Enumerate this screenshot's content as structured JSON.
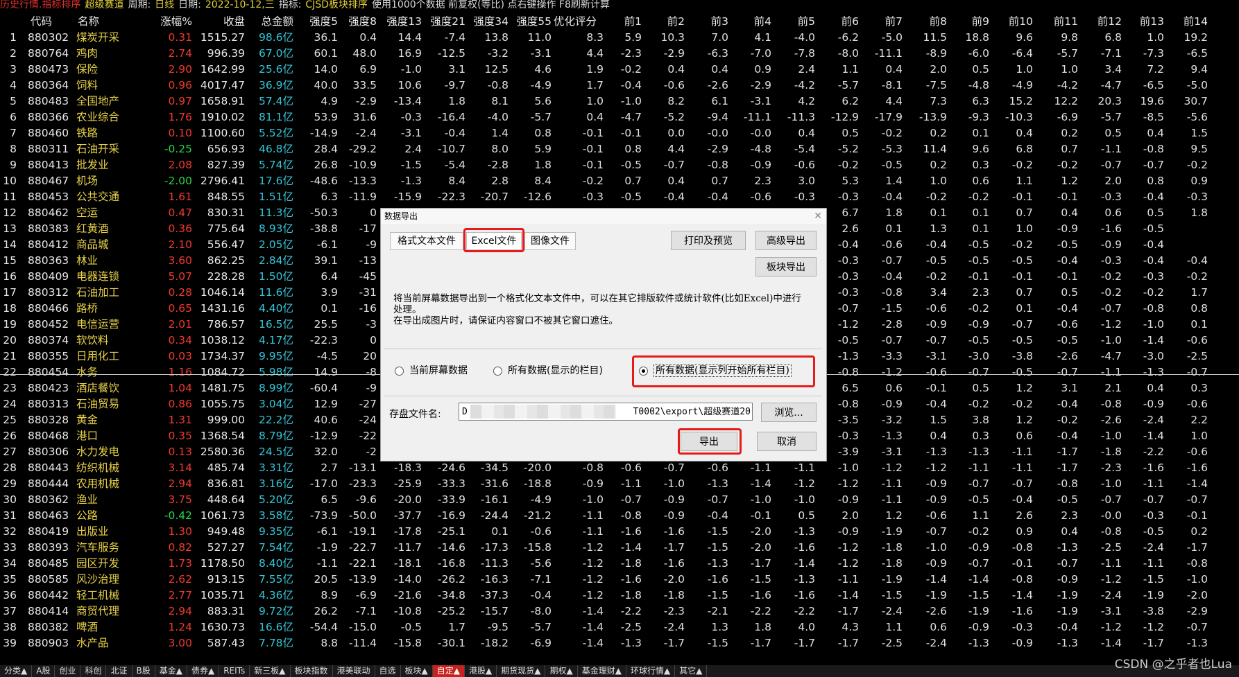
{
  "titlebar": {
    "mode": "历史行情.指标排序",
    "block": "超级赛道",
    "period_label": "周期:",
    "period": "日线",
    "date_label": "日期:",
    "date": "2022-10-12,三",
    "indicator_label": "指标:",
    "indicator": "CJSD板块排序",
    "info": "使用1000个数据 前复权(等比) 点右键操作 F8刷新计算"
  },
  "columns": [
    "代码",
    "名称",
    "涨幅%",
    "收盘",
    "总金额",
    "强度5",
    "强度8",
    "强度13",
    "强度21",
    "强度34",
    "强度55",
    "优化评分",
    "前1",
    "前2",
    "前3",
    "前4",
    "前5",
    "前6",
    "前7",
    "前8",
    "前9",
    "前10",
    "前11",
    "前12",
    "前13",
    "前14"
  ],
  "rows": [
    [
      "1",
      "880302",
      "煤炭开采",
      "0.31",
      "1515.27",
      "98.6亿",
      "36.1",
      "0.4",
      "14.4",
      "-7.4",
      "13.8",
      "11.0",
      "8.3",
      "5.9",
      "10.3",
      "7.0",
      "4.1",
      "-4.0",
      "-6.2",
      "-5.0",
      "11.5",
      "18.8",
      "9.6",
      "9.8",
      "6.8",
      "1.0",
      "19.2"
    ],
    [
      "2",
      "880764",
      "鸡肉",
      "2.74",
      "996.39",
      "67.0亿",
      "60.1",
      "48.0",
      "16.9",
      "-12.5",
      "-3.2",
      "-3.1",
      "4.4",
      "-2.3",
      "-2.9",
      "-6.3",
      "-7.0",
      "-7.8",
      "-8.0",
      "-11.1",
      "-8.9",
      "-6.0",
      "-6.4",
      "-5.7",
      "-7.1",
      "-7.3",
      "-6.5"
    ],
    [
      "3",
      "880473",
      "保险",
      "2.90",
      "1642.99",
      "25.6亿",
      "14.0",
      "6.9",
      "-1.0",
      "3.1",
      "12.5",
      "4.6",
      "1.9",
      "-0.2",
      "0.4",
      "0.4",
      "0.9",
      "2.4",
      "1.1",
      "0.4",
      "2.0",
      "0.5",
      "1.0",
      "1.0",
      "3.4",
      "7.2",
      "9.4"
    ],
    [
      "4",
      "880364",
      "饲料",
      "0.96",
      "4017.47",
      "36.9亿",
      "40.0",
      "33.5",
      "10.6",
      "-9.7",
      "-0.8",
      "-4.9",
      "1.7",
      "-0.4",
      "-0.6",
      "-2.6",
      "-2.9",
      "-4.2",
      "-5.7",
      "-8.1",
      "-7.5",
      "-4.8",
      "-4.9",
      "-4.2",
      "-4.7",
      "-6.5",
      "-5.0"
    ],
    [
      "5",
      "880483",
      "全国地产",
      "0.97",
      "1658.91",
      "57.4亿",
      "4.9",
      "-2.9",
      "-13.4",
      "1.8",
      "8.1",
      "5.6",
      "1.0",
      "-1.0",
      "8.2",
      "6.1",
      "-3.1",
      "4.2",
      "6.2",
      "4.4",
      "7.3",
      "6.3",
      "15.2",
      "12.2",
      "20.3",
      "19.6",
      "30.7"
    ],
    [
      "6",
      "880366",
      "农业综合",
      "1.76",
      "1910.02",
      "81.1亿",
      "53.9",
      "31.6",
      "-0.3",
      "-16.4",
      "-4.0",
      "-5.7",
      "0.4",
      "-4.7",
      "-5.2",
      "-9.4",
      "-11.1",
      "-11.3",
      "-12.9",
      "-17.9",
      "-13.9",
      "-9.3",
      "-10.3",
      "-6.9",
      "-5.7",
      "-8.5",
      "-5.6"
    ],
    [
      "7",
      "880460",
      "铁路",
      "0.10",
      "1100.60",
      "5.52亿",
      "-14.9",
      "-2.4",
      "-3.1",
      "-0.4",
      "1.4",
      "0.8",
      "-0.1",
      "-0.1",
      "0.0",
      "-0.0",
      "-0.0",
      "0.4",
      "0.5",
      "-0.2",
      "0.2",
      "0.1",
      "0.4",
      "0.2",
      "0.5",
      "0.4",
      "1.5"
    ],
    [
      "8",
      "880311",
      "石油开采",
      "-0.25",
      "656.93",
      "46.8亿",
      "28.4",
      "-29.2",
      "2.4",
      "-10.7",
      "8.0",
      "5.9",
      "-0.1",
      "0.8",
      "4.4",
      "-2.9",
      "-4.8",
      "-5.4",
      "-5.2",
      "-5.3",
      "11.4",
      "9.6",
      "6.8",
      "0.7",
      "-1.1",
      "-0.8",
      "9.5"
    ],
    [
      "9",
      "880413",
      "批发业",
      "2.08",
      "827.39",
      "5.74亿",
      "26.8",
      "-10.9",
      "-1.5",
      "-5.4",
      "-2.8",
      "1.8",
      "-0.1",
      "-0.5",
      "-0.7",
      "-0.8",
      "-0.9",
      "-0.6",
      "-0.2",
      "-0.5",
      "0.2",
      "0.3",
      "-0.2",
      "-0.2",
      "-0.7",
      "-0.7",
      "-0.2"
    ],
    [
      "10",
      "880467",
      "机场",
      "-2.00",
      "2796.41",
      "17.6亿",
      "-48.6",
      "-13.3",
      "-1.3",
      "8.4",
      "2.8",
      "8.4",
      "-0.2",
      "0.7",
      "0.4",
      "0.7",
      "2.3",
      "3.0",
      "5.3",
      "1.4",
      "1.0",
      "0.6",
      "1.1",
      "1.2",
      "2.0",
      "0.8",
      "0.9"
    ],
    [
      "11",
      "880453",
      "公共交通",
      "1.61",
      "848.55",
      "1.51亿",
      "6.3",
      "-11.9",
      "-15.9",
      "-22.3",
      "-20.7",
      "-12.6",
      "-0.3",
      "-0.5",
      "-0.4",
      "-0.4",
      "-0.6",
      "-0.3",
      "-0.3",
      "-0.4",
      "-0.2",
      "-0.2",
      "-0.1",
      "-0.1",
      "-0.3",
      "-0.4",
      "-0.3"
    ],
    [
      "12",
      "880462",
      "空运",
      "0.47",
      "830.31",
      "11.3亿",
      "-50.3",
      "0",
      "",
      "",
      "",
      "",
      "",
      "",
      "",
      "",
      "",
      "",
      "6.7",
      "1.8",
      "0.1",
      "0.1",
      "0.7",
      "0.4",
      "0.6",
      "0.5",
      "1.8"
    ],
    [
      "13",
      "880383",
      "红黄酒",
      "0.36",
      "775.64",
      "8.93亿",
      "-38.8",
      "-17",
      "",
      "",
      "",
      "",
      "",
      "",
      "",
      "",
      "",
      "",
      "2.6",
      "0.1",
      "1.3",
      "0.1",
      "1.0",
      "-0.9",
      "-1.6",
      "-0.5",
      ""
    ],
    [
      "14",
      "880412",
      "商品城",
      "2.10",
      "556.47",
      "2.05亿",
      "-6.1",
      "-9",
      "",
      "",
      "",
      "",
      "",
      "",
      "",
      "",
      "",
      "",
      "-0.4",
      "-0.6",
      "-0.4",
      "-0.5",
      "-0.2",
      "-0.5",
      "-0.9",
      "-0.4",
      ""
    ],
    [
      "15",
      "880363",
      "林业",
      "3.60",
      "862.25",
      "2.84亿",
      "39.1",
      "-13",
      "",
      "",
      "",
      "",
      "",
      "",
      "",
      "",
      "",
      "",
      "-0.3",
      "-0.7",
      "-0.5",
      "-0.5",
      "-0.5",
      "-0.4",
      "-0.3",
      "-0.4",
      "-0.4"
    ],
    [
      "16",
      "880409",
      "电器连锁",
      "5.07",
      "228.28",
      "1.50亿",
      "6.4",
      "-45",
      "",
      "",
      "",
      "",
      "",
      "",
      "",
      "",
      "",
      "",
      "-0.3",
      "-0.4",
      "-0.2",
      "-0.1",
      "-0.1",
      "-0.1",
      "-0.2",
      "-0.3",
      "-0.2"
    ],
    [
      "17",
      "880312",
      "石油加工",
      "0.28",
      "1046.14",
      "11.6亿",
      "3.9",
      "-31",
      "",
      "",
      "",
      "",
      "",
      "",
      "",
      "",
      "",
      "",
      "-0.3",
      "-0.8",
      "3.4",
      "2.3",
      "0.7",
      "0.5",
      "-0.2",
      "-0.2",
      "1.7"
    ],
    [
      "18",
      "880466",
      "路桥",
      "0.65",
      "1431.16",
      "4.40亿",
      "0.1",
      "-16",
      "",
      "",
      "",
      "",
      "",
      "",
      "",
      "",
      "",
      "",
      "-0.7",
      "-1.5",
      "-0.6",
      "-0.2",
      "0.1",
      "-0.4",
      "-0.7",
      "-0.8",
      "0.8"
    ],
    [
      "19",
      "880452",
      "电信运营",
      "2.01",
      "786.57",
      "16.5亿",
      "25.5",
      "-3",
      "",
      "",
      "",
      "",
      "",
      "",
      "",
      "",
      "",
      "",
      "-1.2",
      "-2.8",
      "-0.9",
      "-0.9",
      "-0.7",
      "-0.6",
      "-1.2",
      "-1.0",
      "0.1"
    ],
    [
      "20",
      "880374",
      "软饮料",
      "0.34",
      "1038.12",
      "4.17亿",
      "-22.3",
      "0",
      "",
      "",
      "",
      "",
      "",
      "",
      "",
      "",
      "",
      "",
      "-0.5",
      "-0.7",
      "-0.7",
      "-0.5",
      "-0.5",
      "-0.5",
      "-1.0",
      "-1.4",
      "-0.6"
    ],
    [
      "21",
      "880355",
      "日用化工",
      "0.03",
      "1734.37",
      "9.95亿",
      "-4.5",
      "20",
      "",
      "",
      "",
      "",
      "",
      "",
      "",
      "",
      "",
      "",
      "-1.3",
      "-3.3",
      "-3.1",
      "-3.0",
      "-3.8",
      "-2.6",
      "-4.7",
      "-3.0",
      "-2.5"
    ],
    [
      "22",
      "880454",
      "水务",
      "1.16",
      "1084.72",
      "5.98亿",
      "14.9",
      "-8",
      "",
      "",
      "",
      "",
      "",
      "",
      "",
      "",
      "",
      "",
      "-0.8",
      "-1.2",
      "-0.6",
      "-0.7",
      "-0.5",
      "-0.7",
      "-1.1",
      "-1.3",
      "-0.7"
    ],
    [
      "23",
      "880423",
      "酒店餐饮",
      "1.04",
      "1481.75",
      "8.99亿",
      "-60.4",
      "-9",
      "",
      "",
      "",
      "",
      "",
      "",
      "",
      "",
      "",
      "",
      "6.5",
      "0.6",
      "-0.1",
      "0.5",
      "1.2",
      "3.1",
      "2.1",
      "0.4",
      "0.3"
    ],
    [
      "24",
      "880313",
      "石油贸易",
      "0.86",
      "1055.75",
      "3.04亿",
      "12.9",
      "-27",
      "",
      "",
      "",
      "",
      "",
      "",
      "",
      "",
      "",
      "",
      "-0.8",
      "-0.9",
      "-0.4",
      "-0.2",
      "-0.2",
      "-0.4",
      "-0.8",
      "-0.9",
      "-0.6"
    ],
    [
      "25",
      "880328",
      "黄金",
      "1.31",
      "999.00",
      "22.2亿",
      "40.6",
      "-24",
      "",
      "",
      "",
      "",
      "",
      "",
      "",
      "",
      "",
      "",
      "-3.5",
      "-3.2",
      "1.5",
      "3.8",
      "1.2",
      "-0.2",
      "-2.6",
      "-2.4",
      "2.2"
    ],
    [
      "26",
      "880468",
      "港口",
      "0.35",
      "1368.54",
      "8.79亿",
      "-12.9",
      "-22",
      "",
      "",
      "",
      "",
      "",
      "",
      "",
      "",
      "",
      "",
      "-0.3",
      "-1.3",
      "0.4",
      "0.3",
      "0.6",
      "-0.4",
      "-1.0",
      "-1.4",
      "1.0"
    ],
    [
      "27",
      "880306",
      "水力发电",
      "0.13",
      "2580.36",
      "24.5亿",
      "32.0",
      "-2",
      "",
      "",
      "",
      "",
      "",
      "",
      "",
      "",
      "",
      "",
      "-3.9",
      "-3.1",
      "-1.3",
      "-1.3",
      "-1.1",
      "-1.7",
      "-1.8",
      "-2.2",
      "-0.6"
    ],
    [
      "28",
      "880443",
      "纺织机械",
      "3.14",
      "485.74",
      "3.31亿",
      "2.7",
      "-13.1",
      "-18.3",
      "-24.6",
      "-34.5",
      "-20.0",
      "-0.8",
      "-0.6",
      "-0.7",
      "-0.6",
      "-1.1",
      "-1.1",
      "-1.0",
      "-1.2",
      "-1.2",
      "-1.1",
      "-1.1",
      "-1.7",
      "-2.3",
      "-1.6",
      "-1.6"
    ],
    [
      "29",
      "880444",
      "农用机械",
      "2.94",
      "836.81",
      "3.16亿",
      "-17.0",
      "-23.3",
      "-25.9",
      "-33.3",
      "-31.6",
      "-18.8",
      "-0.9",
      "-1.1",
      "-1.0",
      "-1.3",
      "-1.4",
      "-1.2",
      "-1.2",
      "-1.1",
      "-0.9",
      "-0.7",
      "-0.7",
      "-0.8",
      "-1.0",
      "-1.1",
      "-1.4"
    ],
    [
      "30",
      "880362",
      "渔业",
      "3.75",
      "448.64",
      "5.20亿",
      "6.5",
      "-9.6",
      "-20.0",
      "-33.9",
      "-16.1",
      "-4.9",
      "-1.0",
      "-0.7",
      "-0.9",
      "-0.7",
      "-1.0",
      "-1.0",
      "-0.9",
      "-1.1",
      "-0.9",
      "-0.5",
      "-0.4",
      "-0.5",
      "-0.7",
      "-0.7",
      "-0.7"
    ],
    [
      "31",
      "880463",
      "公路",
      "-0.42",
      "1061.73",
      "3.58亿",
      "-73.9",
      "-50.0",
      "-37.7",
      "-16.9",
      "-24.4",
      "-21.2",
      "-1.1",
      "-0.8",
      "-0.9",
      "-0.4",
      "-0.1",
      "0.5",
      "2.0",
      "1.2",
      "-0.6",
      "1.1",
      "2.6",
      "2.3",
      "-0.0",
      "-0.3",
      "-0.1"
    ],
    [
      "32",
      "880419",
      "出版业",
      "1.30",
      "949.48",
      "9.35亿",
      "-6.1",
      "-19.1",
      "-17.8",
      "-25.1",
      "0.1",
      "-0.6",
      "-1.1",
      "-1.6",
      "-1.6",
      "-1.5",
      "-2.0",
      "-1.3",
      "-0.9",
      "-1.9",
      "-0.7",
      "-0.2",
      "0.9",
      "0.4",
      "-0.8",
      "-0.5",
      "0.2"
    ],
    [
      "33",
      "880393",
      "汽车服务",
      "0.82",
      "527.27",
      "7.54亿",
      "-1.9",
      "-22.7",
      "-11.7",
      "-14.6",
      "-17.3",
      "-15.8",
      "-1.2",
      "-1.4",
      "-1.7",
      "-1.5",
      "-2.0",
      "-1.6",
      "-1.2",
      "-1.8",
      "-1.0",
      "-0.9",
      "-0.8",
      "-1.3",
      "-2.5",
      "-2.4",
      "-1.7"
    ],
    [
      "34",
      "880485",
      "园区开发",
      "1.73",
      "1178.50",
      "8.40亿",
      "-1.1",
      "-22.1",
      "-18.1",
      "-16.8",
      "-11.3",
      "-5.6",
      "-1.2",
      "-1.8",
      "-1.6",
      "-1.3",
      "-1.7",
      "-1.4",
      "-1.2",
      "-1.8",
      "-0.9",
      "-0.7",
      "-0.1",
      "-0.7",
      "-1.1",
      "-1.1",
      "-0.8"
    ],
    [
      "35",
      "880585",
      "风沙治理",
      "2.62",
      "913.15",
      "7.55亿",
      "20.5",
      "-13.9",
      "-14.0",
      "-26.2",
      "-16.3",
      "-7.1",
      "-1.2",
      "-1.6",
      "-2.0",
      "-1.6",
      "-1.5",
      "-1.3",
      "-1.1",
      "-1.9",
      "-1.4",
      "-1.4",
      "-0.8",
      "-0.9",
      "-1.2",
      "-1.5",
      "-1.0"
    ],
    [
      "36",
      "880442",
      "轻工机械",
      "2.77",
      "1035.71",
      "4.36亿",
      "8.9",
      "-6.9",
      "-21.6",
      "-34.8",
      "-37.3",
      "-0.4",
      "-1.2",
      "-1.8",
      "-1.8",
      "-1.5",
      "-1.6",
      "-1.6",
      "-1.4",
      "-1.5",
      "-1.9",
      "-1.5",
      "-1.4",
      "-1.9",
      "-2.4",
      "-1.9",
      "-2.0"
    ],
    [
      "37",
      "880414",
      "商贸代理",
      "2.94",
      "883.31",
      "9.72亿",
      "26.2",
      "-7.1",
      "-10.8",
      "-25.2",
      "-15.7",
      "-8.0",
      "-1.4",
      "-2.2",
      "-2.3",
      "-2.1",
      "-2.2",
      "-2.2",
      "-1.7",
      "-2.4",
      "-2.6",
      "-1.9",
      "-1.6",
      "-1.9",
      "-3.1",
      "-3.8",
      "-2.9"
    ],
    [
      "38",
      "880382",
      "啤酒",
      "1.24",
      "1630.73",
      "16.6亿",
      "-54.4",
      "-15.0",
      "-0.5",
      "1.7",
      "-9.5",
      "-5.7",
      "-1.4",
      "-2.5",
      "-2.4",
      "1.3",
      "1.8",
      "4.0",
      "4.3",
      "1.1",
      "0.6",
      "-0.9",
      "-0.3",
      "-0.4",
      "-1.2",
      "-1.2",
      "-0.7"
    ],
    [
      "39",
      "880903",
      "水产品",
      "3.00",
      "587.43",
      "7.78亿",
      "8.8",
      "-11.4",
      "-15.8",
      "-30.1",
      "-18.2",
      "-6.9",
      "-1.4",
      "-1.3",
      "-1.7",
      "-1.5",
      "-1.7",
      "-1.7",
      "-1.7",
      "-2.5",
      "-2.4",
      "-1.3",
      "-0.9",
      "-1.3",
      "-1.4",
      "-1.7",
      "-1.3"
    ]
  ],
  "dialog": {
    "title": "数据导出",
    "tabs": [
      "格式文本文件",
      "Excel文件",
      "图像文件"
    ],
    "active_tab": "Excel文件",
    "btn_print": "打印及预览",
    "btn_advanced": "高级导出",
    "btn_block": "板块导出",
    "description": "将当前屏幕数据导出到一个格式化文本文件中，可以在其它排版软件或统计软件(比如Excel)中进行处理。\n在导出成图片时，请保证内容窗口不被其它窗口遮住。",
    "radio_current": "当前屏幕数据",
    "radio_all_visible": "所有数据(显示的栏目)",
    "radio_all_columns": "所有数据(显示列开始所有栏目)",
    "selected_radio": "所有数据(显示列开始所有栏目)",
    "path_label": "存盘文件名:",
    "path_start": "D",
    "path_end": "T0002\\export\\超级赛道20",
    "btn_browse": "浏览...",
    "btn_export": "导出",
    "btn_cancel": "取消"
  },
  "bottom_tabs": [
    "分类▲",
    "A股",
    "创业",
    "科创",
    "北证",
    "B股",
    "基金▲",
    "债券▲",
    "REITs",
    "新三板▲",
    "板块指数",
    "港美联动",
    "自选",
    "板块▲",
    "自定▲",
    "港股▲",
    "期货现货▲",
    "期权▲",
    "基金理财▲",
    "环球行情▲",
    "其它▲"
  ],
  "bottom_active": "自定▲",
  "watermark": "CSDN @之乎者也Lua"
}
